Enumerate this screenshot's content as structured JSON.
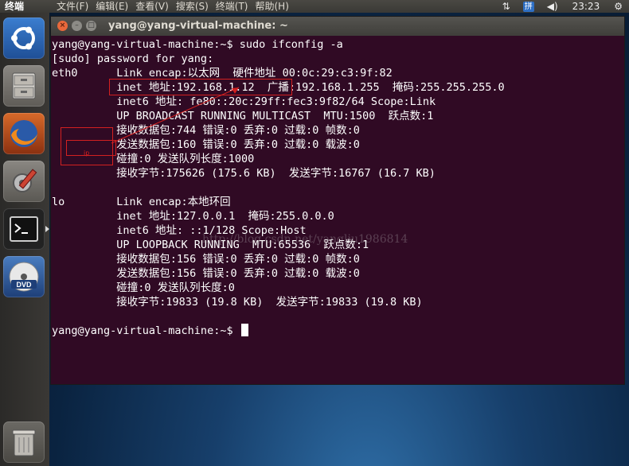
{
  "topbar": {
    "app_name": "终端",
    "menu": [
      "文件(F)",
      "编辑(E)",
      "查看(V)",
      "搜索(S)",
      "终端(T)",
      "帮助(H)"
    ],
    "tray": {
      "keyboard": "拼",
      "clock": "23:23"
    }
  },
  "launcher": {
    "items": [
      "ubuntu-dash",
      "files",
      "firefox",
      "system-settings",
      "terminal",
      "dvd",
      "trash"
    ]
  },
  "window": {
    "title": "yang@yang-virtual-machine: ~"
  },
  "terminal": {
    "lines": [
      "yang@yang-virtual-machine:~$ sudo ifconfig -a",
      "[sudo] password for yang:",
      "eth0      Link encap:以太网  硬件地址 00:0c:29:c3:9f:82",
      "          inet 地址:192.168.1.12  广播:192.168.1.255  掩码:255.255.255.0",
      "          inet6 地址: fe80::20c:29ff:fec3:9f82/64 Scope:Link",
      "          UP BROADCAST RUNNING MULTICAST  MTU:1500  跃点数:1",
      "          接收数据包:744 错误:0 丢弃:0 过载:0 帧数:0",
      "          发送数据包:160 错误:0 丢弃:0 过载:0 载波:0",
      "          碰撞:0 发送队列长度:1000",
      "          接收字节:175626 (175.6 KB)  发送字节:16767 (16.7 KB)",
      "",
      "lo        Link encap:本地环回",
      "          inet 地址:127.0.0.1  掩码:255.0.0.0",
      "          inet6 地址: ::1/128 Scope:Host",
      "          UP LOOPBACK RUNNING  MTU:65536  跃点数:1",
      "          接收数据包:156 错误:0 丢弃:0 过载:0 帧数:0",
      "          发送数据包:156 错误:0 丢弃:0 过载:0 载波:0",
      "          碰撞:0 发送队列长度:0",
      "          接收字节:19833 (19.8 KB)  发送字节:19833 (19.8 KB)",
      "",
      "yang@yang-virtual-machine:~$ "
    ]
  },
  "annotation": {
    "label": "ip",
    "color": "#d32020"
  },
  "watermark": "http://blog.csdn.net/yangliu1986814",
  "colors": {
    "terminal_bg": "#300a24",
    "terminal_fg": "#ffffff",
    "launcher_bg": "#2b2a28"
  }
}
